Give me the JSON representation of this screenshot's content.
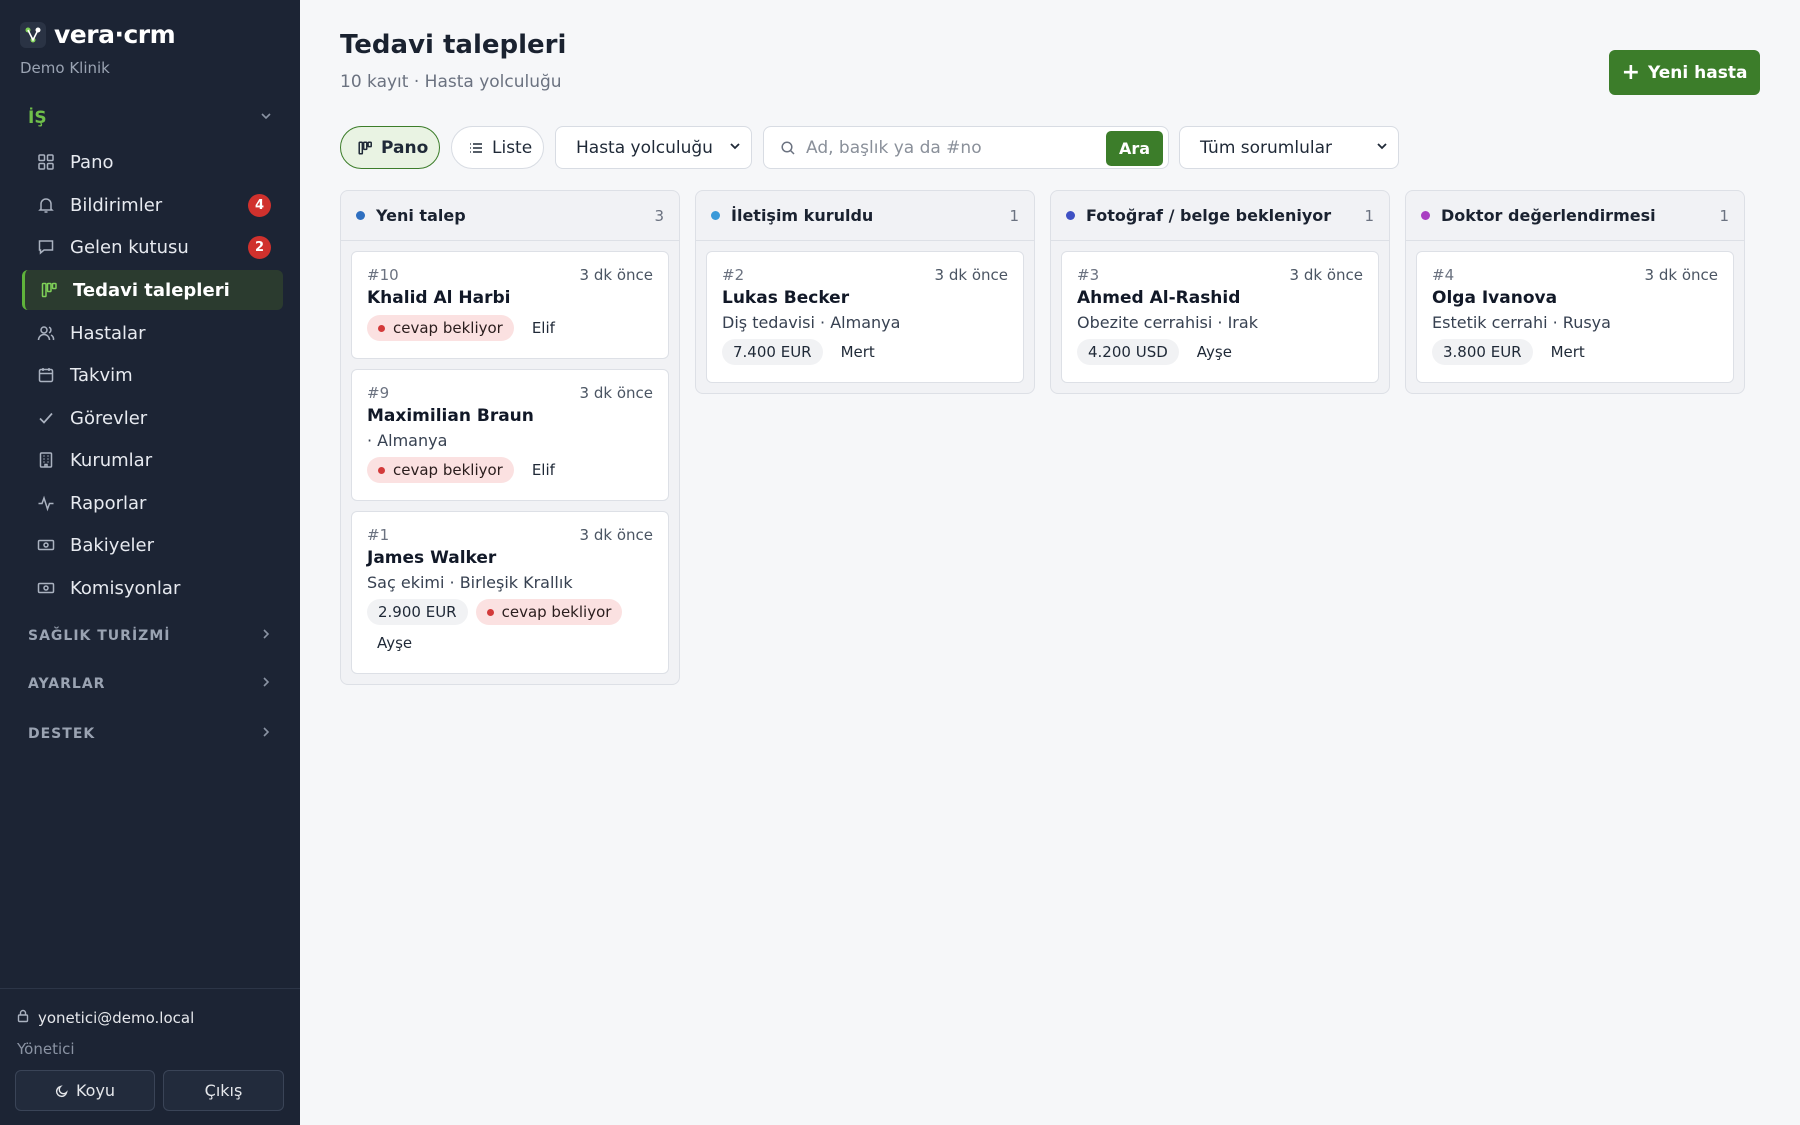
{
  "brand": {
    "name": "vera·crm",
    "subtitle": "Demo Klinik"
  },
  "sidebar": {
    "active_section": "İŞ",
    "items": [
      {
        "label": "Pano",
        "icon": "grid-icon"
      },
      {
        "label": "Bildirimler",
        "icon": "bell-icon",
        "badge": "4"
      },
      {
        "label": "Gelen kutusu",
        "icon": "chat-icon",
        "badge": "2"
      },
      {
        "label": "Tedavi talepleri",
        "icon": "kanban-icon"
      },
      {
        "label": "Hastalar",
        "icon": "users-icon"
      },
      {
        "label": "Takvim",
        "icon": "calendar-icon"
      },
      {
        "label": "Görevler",
        "icon": "check-icon"
      },
      {
        "label": "Kurumlar",
        "icon": "building-icon"
      },
      {
        "label": "Raporlar",
        "icon": "activity-icon"
      },
      {
        "label": "Bakiyeler",
        "icon": "cash-icon"
      },
      {
        "label": "Komisyonlar",
        "icon": "cash-icon"
      }
    ],
    "sections": [
      "SAĞLIK TURİZMİ",
      "AYARLAR",
      "DESTEK"
    ],
    "user": {
      "email": "yonetici@demo.local",
      "role": "Yönetici"
    },
    "dark_label": "Koyu",
    "logout_label": "Çıkış"
  },
  "header": {
    "title": "Tedavi talepleri",
    "subtitle": "10 kayıt · Hasta yolculuğu",
    "new_button": "Yeni hasta"
  },
  "toolbar": {
    "board_label": "Pano",
    "list_label": "Liste",
    "pipeline_select": "Hasta yolculuğu",
    "search_placeholder": "Ad, başlık ya da #no",
    "search_button": "Ara",
    "owner_select": "Tüm sorumlular"
  },
  "board": {
    "columns": [
      {
        "title": "Yeni talep",
        "count": "3",
        "color": "#2f6fc0",
        "cards": [
          {
            "id": "#10",
            "time": "3 dk önce",
            "name": "Khalid Al Harbi",
            "tags": [
              {
                "text": "cevap bekliyor",
                "kind": "warn"
              },
              {
                "text": "Elif",
                "kind": "name"
              }
            ]
          },
          {
            "id": "#9",
            "time": "3 dk önce",
            "name": "Maximilian Braun",
            "sub": "· Almanya",
            "tags": [
              {
                "text": "cevap bekliyor",
                "kind": "warn"
              },
              {
                "text": "Elif",
                "kind": "name"
              }
            ]
          },
          {
            "id": "#1",
            "time": "3 dk önce",
            "name": "James Walker",
            "sub": "Saç ekimi · Birleşik Krallık",
            "tags": [
              {
                "text": "2.900 EUR",
                "kind": "plain"
              },
              {
                "text": "cevap bekliyor",
                "kind": "warn"
              },
              {
                "text": "Ayşe",
                "kind": "name"
              }
            ]
          }
        ]
      },
      {
        "title": "İletişim kuruldu",
        "count": "1",
        "color": "#3b9ad9",
        "cards": [
          {
            "id": "#2",
            "time": "3 dk önce",
            "name": "Lukas Becker",
            "sub": "Diş tedavisi · Almanya",
            "tags": [
              {
                "text": "7.400 EUR",
                "kind": "plain"
              },
              {
                "text": "Mert",
                "kind": "name"
              }
            ]
          }
        ]
      },
      {
        "title": "Fotoğraf / belge bekleniyor",
        "count": "1",
        "color": "#3f51c4",
        "cards": [
          {
            "id": "#3",
            "time": "3 dk önce",
            "name": "Ahmed Al-Rashid",
            "sub": "Obezite cerrahisi · Irak",
            "tags": [
              {
                "text": "4.200 USD",
                "kind": "plain"
              },
              {
                "text": "Ayşe",
                "kind": "name"
              }
            ]
          }
        ]
      },
      {
        "title": "Doktor değerlendirmesi",
        "count": "1",
        "color": "#a93fc2",
        "cards": [
          {
            "id": "#4",
            "time": "3 dk önce",
            "name": "Olga Ivanova",
            "sub": "Estetik cerrahi · Rusya",
            "tags": [
              {
                "text": "3.800 EUR",
                "kind": "plain"
              },
              {
                "text": "Mert",
                "kind": "name"
              }
            ]
          }
        ]
      }
    ]
  },
  "colors": {
    "accent": "#3c7d2a",
    "sidebar_bg": "#1c2434",
    "badge": "#d0312d"
  }
}
